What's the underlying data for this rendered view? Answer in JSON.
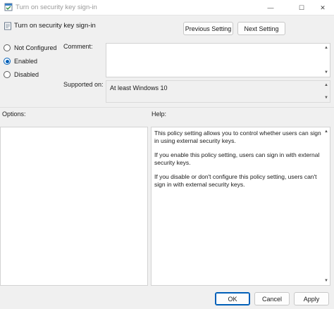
{
  "window": {
    "title": "Turn on security key sign-in",
    "minimize_glyph": "—",
    "maximize_glyph": "☐",
    "close_glyph": "✕"
  },
  "header": {
    "policy_title": "Turn on security key sign-in",
    "previous_label": "Previous Setting",
    "next_label": "Next Setting"
  },
  "state": {
    "options": [
      {
        "label": "Not Configured",
        "checked": false
      },
      {
        "label": "Enabled",
        "checked": true
      },
      {
        "label": "Disabled",
        "checked": false
      }
    ]
  },
  "comment": {
    "label": "Comment:",
    "value": ""
  },
  "supported": {
    "label": "Supported on:",
    "value": "At least Windows 10"
  },
  "options_panel": {
    "label": "Options:"
  },
  "help_panel": {
    "label": "Help:",
    "paragraphs": [
      "This policy setting allows you to control whether users can sign in using external security keys.",
      "If you enable this policy setting, users can sign in with external security keys.",
      "If you disable or don't configure this policy setting, users can't sign in with external security keys."
    ]
  },
  "footer": {
    "ok_label": "OK",
    "cancel_label": "Cancel",
    "apply_label": "Apply"
  },
  "colors": {
    "accent": "#005fb8"
  },
  "icons": {
    "app": "policy-editor-icon",
    "policy": "policy-setting-icon"
  }
}
